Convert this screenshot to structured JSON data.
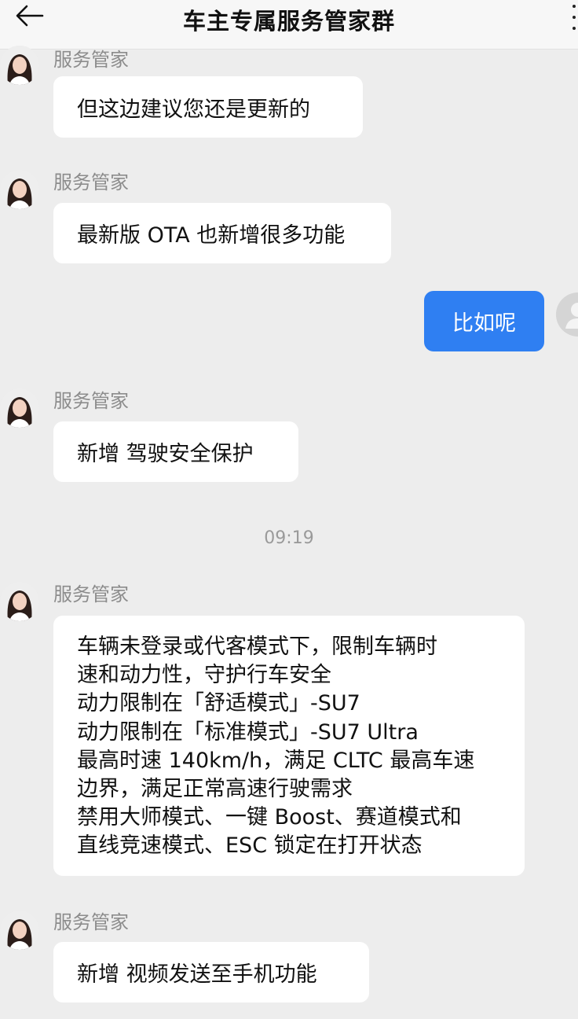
{
  "header": {
    "title": "车主专属服务管家群"
  },
  "messages": [
    {
      "sender": "服务管家",
      "text": "但这边建议您还是更新的"
    },
    {
      "sender": "服务管家",
      "text": "最新版 OTA 也新增很多功能"
    },
    {
      "self_text": "比如呢"
    },
    {
      "sender": "服务管家",
      "text": "新增 驾驶安全保护"
    },
    {
      "timestamp": "09:19"
    },
    {
      "sender": "服务管家",
      "lines": [
        "车辆未登录或代客模式下，限制车辆时",
        "速和动力性，守护行车安全",
        "动力限制在「舒适模式」-SU7",
        "动力限制在「标准模式」-SU7 Ultra",
        "最高时速 140km/h，满足 CLTC 最高车速",
        "边界，满足正常高速行驶需求",
        "禁用大师模式、一键 Boost、赛道模式和",
        "直线竞速模式、ESC 锁定在打开状态"
      ]
    },
    {
      "sender": "服务管家",
      "text": "新增 视频发送至手机功能"
    }
  ],
  "colors": {
    "background": "#ededed",
    "bubble_incoming": "#ffffff",
    "bubble_outgoing": "#2f7ff2",
    "sender_name": "#8c8c8c"
  },
  "icons": {
    "back": "back-arrow-icon",
    "more": "more-vertical-icon"
  }
}
